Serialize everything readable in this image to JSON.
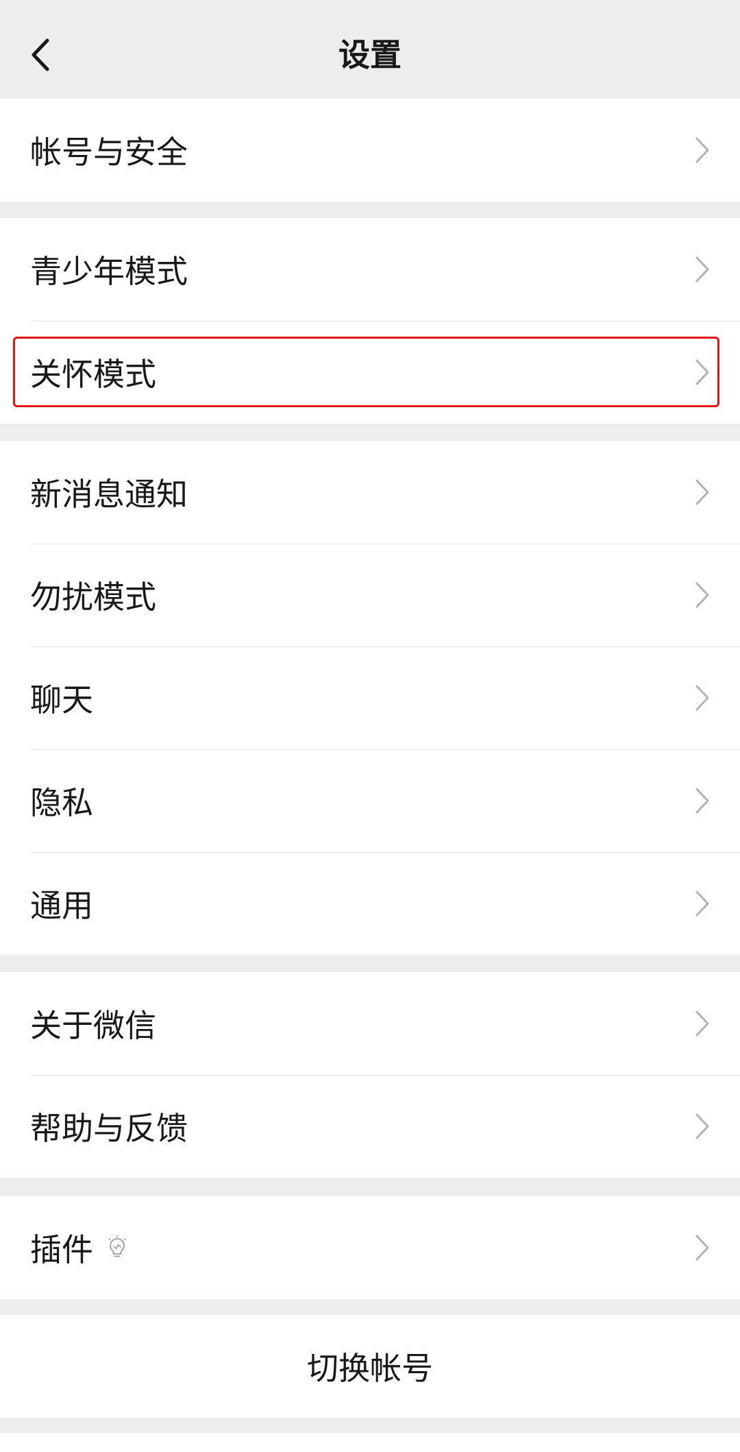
{
  "nav": {
    "title": "设置",
    "back_icon": "chevron-left-icon"
  },
  "groups": [
    {
      "items": [
        {
          "label": "帐号与安全"
        }
      ]
    },
    {
      "items": [
        {
          "label": "青少年模式"
        },
        {
          "label": "关怀模式",
          "highlighted": true
        }
      ]
    },
    {
      "items": [
        {
          "label": "新消息通知"
        },
        {
          "label": "勿扰模式"
        },
        {
          "label": "聊天"
        },
        {
          "label": "隐私"
        },
        {
          "label": "通用"
        }
      ]
    },
    {
      "items": [
        {
          "label": "关于微信"
        },
        {
          "label": "帮助与反馈"
        }
      ]
    },
    {
      "items": [
        {
          "label": "插件",
          "icon": "lightbulb-icon"
        }
      ]
    }
  ],
  "switch_account": {
    "label": "切换帐号"
  },
  "colors": {
    "background": "#ededed",
    "card": "#ffffff",
    "text": "#191919",
    "chevron": "#b2b2b2",
    "highlight": "#e0161b"
  }
}
